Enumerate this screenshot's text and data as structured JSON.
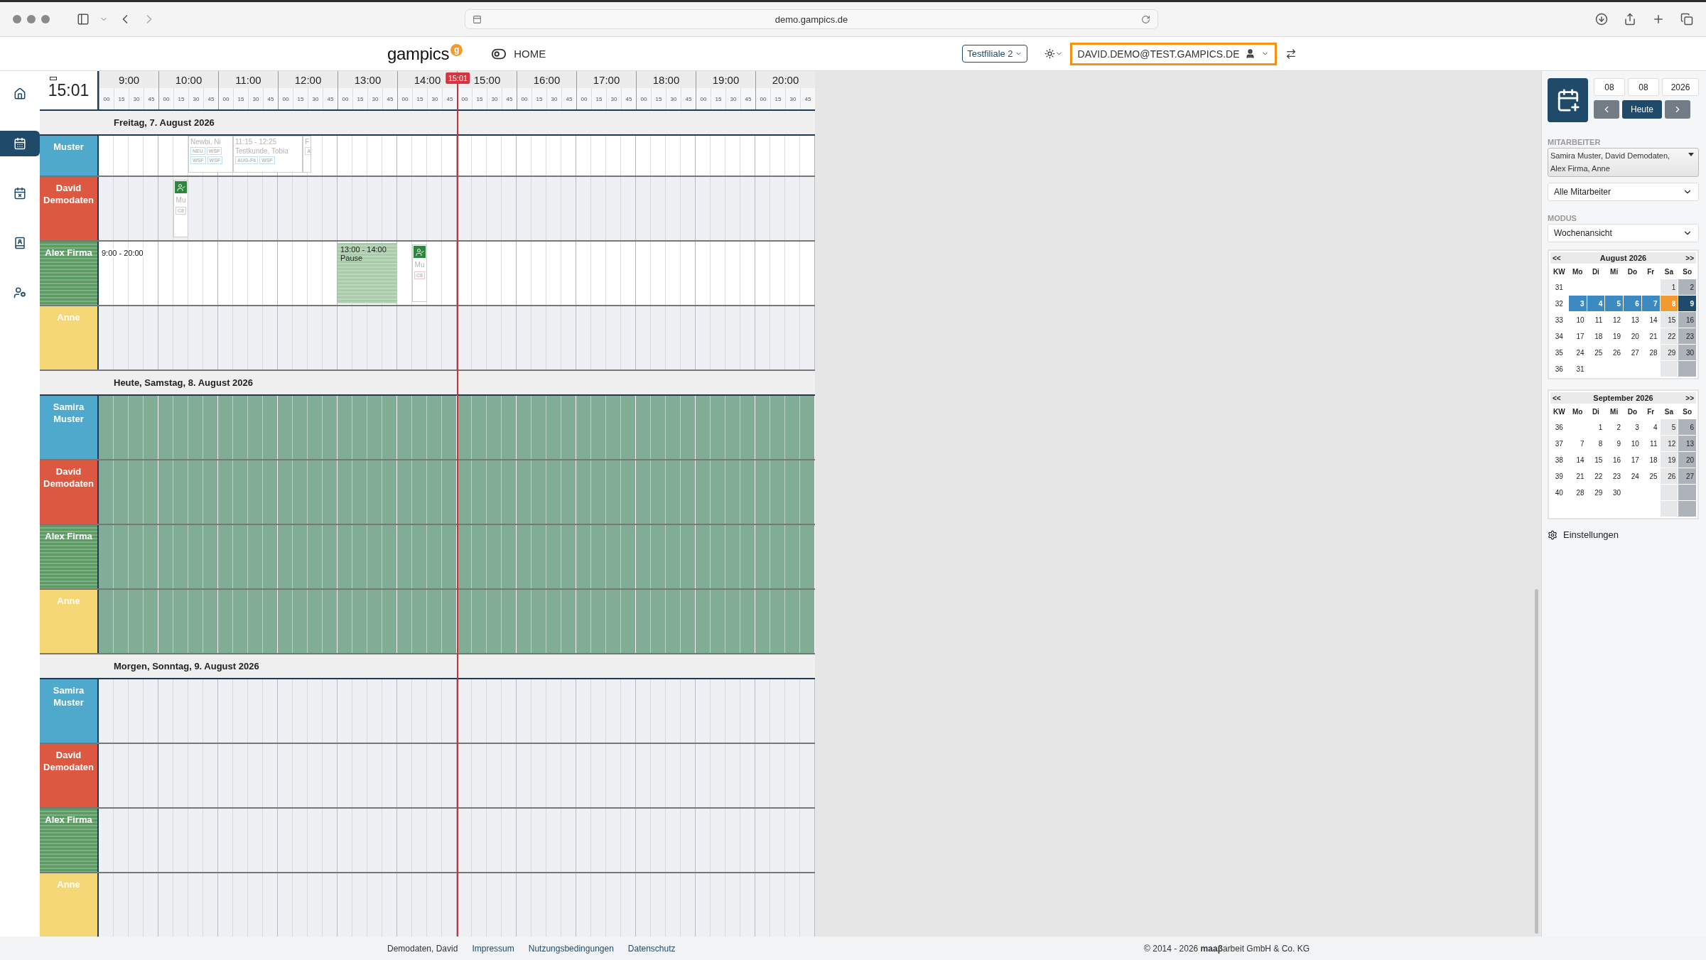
{
  "browser": {
    "url": "demo.gampics.de"
  },
  "header": {
    "logo": "gampics",
    "logo_badge": "g",
    "home": "HOME",
    "branch": "Testfiliale 2",
    "user": "DAVID.DEMO@TEST.GAMPICS.DE"
  },
  "nav": [
    {
      "kind": "home",
      "selected": false
    },
    {
      "kind": "calendar",
      "selected": true
    },
    {
      "kind": "calendar-x",
      "selected": false
    },
    {
      "kind": "contacts",
      "selected": false
    },
    {
      "kind": "user-settings",
      "selected": false
    }
  ],
  "timeline": {
    "clock": "15:01",
    "now": "15:01",
    "hours": [
      {
        "label": "9:00",
        "quarters": [
          "00",
          "15",
          "30",
          "45"
        ]
      },
      {
        "label": "10:00",
        "quarters": [
          "00",
          "15",
          "30",
          "45"
        ]
      },
      {
        "label": "11:00",
        "quarters": [
          "00",
          "15",
          "30",
          "45"
        ]
      },
      {
        "label": "12:00",
        "quarters": [
          "00",
          "15",
          "30",
          "45"
        ]
      },
      {
        "label": "13:00",
        "quarters": [
          "00",
          "15",
          "30",
          "45"
        ]
      },
      {
        "label": "14:00",
        "quarters": [
          "00",
          "15",
          "30",
          "45"
        ]
      },
      {
        "label": "15:00",
        "quarters": [
          "00",
          "15",
          "30",
          "45"
        ]
      },
      {
        "label": "16:00",
        "quarters": [
          "00",
          "15",
          "30",
          "45"
        ]
      },
      {
        "label": "17:00",
        "quarters": [
          "00",
          "15",
          "30",
          "45"
        ]
      },
      {
        "label": "18:00",
        "quarters": [
          "00",
          "15",
          "30",
          "45"
        ]
      },
      {
        "label": "19:00",
        "quarters": [
          "00",
          "15",
          "30",
          "45"
        ]
      },
      {
        "label": "20:00",
        "quarters": [
          "00",
          "15",
          "30",
          "45"
        ]
      }
    ]
  },
  "days": [
    {
      "title": "Freitag, 7. August 2026",
      "rows": [
        {
          "name": "Muster",
          "color": "#4fa9cc",
          "striped": false,
          "partial": true,
          "kind": "working",
          "events": [
            {
              "kind": "appointment",
              "lines": [
                "Newbi, Ni"
              ],
              "tags": [
                "NEU",
                "WSF",
                "WSF",
                "WSF"
              ]
            },
            {
              "kind": "appointment",
              "time": "11:15 - 12:25",
              "lines": [
                "Testkunde, Tobia"
              ],
              "tags": [
                "AUG-Fä",
                "WSF"
              ]
            },
            {
              "kind": "appointment",
              "lines": [
                "F"
              ],
              "tags": [
                "A"
              ]
            }
          ]
        },
        {
          "name": "David Demodaten",
          "color": "#dc5840",
          "striped": false,
          "partial": false,
          "kind": "off",
          "events": [
            {
              "kind": "checkin",
              "lines": [
                "Mu"
              ],
              "tags": [
                "C8"
              ]
            }
          ]
        },
        {
          "name": "Alex Firma",
          "color": "#5b9a62",
          "striped": true,
          "partial": false,
          "kind": "working",
          "shift": "9:00 - 20:00",
          "events": [
            {
              "kind": "pause",
              "time": "13:00 - 14:00",
              "lines": [
                "Pause"
              ]
            },
            {
              "kind": "checkin",
              "lines": [
                "Mu"
              ],
              "tags": [
                "C8"
              ]
            }
          ]
        },
        {
          "name": "Anne",
          "color": "#f6d776",
          "striped": false,
          "partial": false,
          "kind": "off",
          "events": []
        }
      ]
    },
    {
      "title": "Heute, Samstag, 8. August 2026",
      "rows": [
        {
          "name": "Samira Muster",
          "color": "#4fa9cc",
          "striped": false,
          "partial": false,
          "kind": "holiday",
          "events": []
        },
        {
          "name": "David Demodaten",
          "color": "#dc5840",
          "striped": false,
          "partial": false,
          "kind": "holiday",
          "events": []
        },
        {
          "name": "Alex Firma",
          "color": "#5b9a62",
          "striped": true,
          "partial": false,
          "kind": "holiday",
          "events": []
        },
        {
          "name": "Anne",
          "color": "#f6d776",
          "striped": false,
          "partial": false,
          "kind": "holiday",
          "events": []
        }
      ]
    },
    {
      "title": "Morgen, Sonntag, 9. August 2026",
      "rows": [
        {
          "name": "Samira Muster",
          "color": "#4fa9cc",
          "striped": false,
          "partial": false,
          "kind": "off",
          "events": []
        },
        {
          "name": "David Demodaten",
          "color": "#dc5840",
          "striped": false,
          "partial": false,
          "kind": "off",
          "events": []
        },
        {
          "name": "Alex Firma",
          "color": "#5b9a62",
          "striped": true,
          "partial": false,
          "kind": "off",
          "events": []
        },
        {
          "name": "Anne",
          "color": "#f6d776",
          "striped": false,
          "partial": false,
          "kind": "off",
          "events": []
        }
      ]
    }
  ],
  "sidebar": {
    "date": [
      "08",
      "08",
      "2026"
    ],
    "today": "Heute",
    "staff_label": "MITARBEITER",
    "staff": "Samira Muster, David Demodaten, Alex Firma, Anne",
    "staff_filter": "Alle Mitarbeiter",
    "mode_label": "MODUS",
    "mode": "Wochenansicht",
    "calendars": [
      {
        "prev": "<<",
        "title": "August 2026",
        "next": ">>",
        "headers": [
          "KW",
          "Mo",
          "Di",
          "Mi",
          "Do",
          "Fr",
          "Sa",
          "So"
        ],
        "weeks": [
          {
            "kw": "31",
            "days": [
              {
                "empty": true
              },
              {
                "empty": true
              },
              {
                "empty": true
              },
              {
                "empty": true
              },
              {
                "empty": true
              },
              {
                "d": "1",
                "selected": false,
                "today": false
              },
              {
                "d": "2",
                "selected": false,
                "today": false
              }
            ]
          },
          {
            "kw": "32",
            "days": [
              {
                "d": "3",
                "selected": true,
                "today": false
              },
              {
                "d": "4",
                "selected": true,
                "today": false
              },
              {
                "d": "5",
                "selected": true,
                "today": false
              },
              {
                "d": "6",
                "selected": true,
                "today": false
              },
              {
                "d": "7",
                "selected": true,
                "today": false
              },
              {
                "d": "8",
                "selected": true,
                "today": true
              },
              {
                "d": "9",
                "selected": true,
                "today": false
              }
            ]
          },
          {
            "kw": "33",
            "days": [
              {
                "d": "10",
                "selected": false,
                "today": false
              },
              {
                "d": "11",
                "selected": false,
                "today": false
              },
              {
                "d": "12",
                "selected": false,
                "today": false
              },
              {
                "d": "13",
                "selected": false,
                "today": false
              },
              {
                "d": "14",
                "selected": false,
                "today": false
              },
              {
                "d": "15",
                "selected": false,
                "today": false
              },
              {
                "d": "16",
                "selected": false,
                "today": false
              }
            ]
          },
          {
            "kw": "34",
            "days": [
              {
                "d": "17",
                "selected": false,
                "today": false
              },
              {
                "d": "18",
                "selected": false,
                "today": false
              },
              {
                "d": "19",
                "selected": false,
                "today": false
              },
              {
                "d": "20",
                "selected": false,
                "today": false
              },
              {
                "d": "21",
                "selected": false,
                "today": false
              },
              {
                "d": "22",
                "selected": false,
                "today": false
              },
              {
                "d": "23",
                "selected": false,
                "today": false
              }
            ]
          },
          {
            "kw": "35",
            "days": [
              {
                "d": "24",
                "selected": false,
                "today": false
              },
              {
                "d": "25",
                "selected": false,
                "today": false
              },
              {
                "d": "26",
                "selected": false,
                "today": false
              },
              {
                "d": "27",
                "selected": false,
                "today": false
              },
              {
                "d": "28",
                "selected": false,
                "today": false
              },
              {
                "d": "29",
                "selected": false,
                "today": false
              },
              {
                "d": "30",
                "selected": false,
                "today": false
              }
            ]
          },
          {
            "kw": "36",
            "days": [
              {
                "d": "31",
                "selected": false,
                "today": false
              },
              {
                "empty": true
              },
              {
                "empty": true
              },
              {
                "empty": true
              },
              {
                "empty": true
              },
              {
                "empty": true
              },
              {
                "empty": true
              }
            ]
          }
        ]
      },
      {
        "prev": "<<",
        "title": "September 2026",
        "next": ">>",
        "headers": [
          "KW",
          "Mo",
          "Di",
          "Mi",
          "Do",
          "Fr",
          "Sa",
          "So"
        ],
        "weeks": [
          {
            "kw": "36",
            "days": [
              {
                "empty": true
              },
              {
                "d": "1",
                "selected": false,
                "today": false
              },
              {
                "d": "2",
                "selected": false,
                "today": false
              },
              {
                "d": "3",
                "selected": false,
                "today": false
              },
              {
                "d": "4",
                "selected": false,
                "today": false
              },
              {
                "d": "5",
                "selected": false,
                "today": false
              },
              {
                "d": "6",
                "selected": false,
                "today": false
              }
            ]
          },
          {
            "kw": "37",
            "days": [
              {
                "d": "7",
                "selected": false,
                "today": false
              },
              {
                "d": "8",
                "selected": false,
                "today": false
              },
              {
                "d": "9",
                "selected": false,
                "today": false
              },
              {
                "d": "10",
                "selected": false,
                "today": false
              },
              {
                "d": "11",
                "selected": false,
                "today": false
              },
              {
                "d": "12",
                "selected": false,
                "today": false
              },
              {
                "d": "13",
                "selected": false,
                "today": false
              }
            ]
          },
          {
            "kw": "38",
            "days": [
              {
                "d": "14",
                "selected": false,
                "today": false
              },
              {
                "d": "15",
                "selected": false,
                "today": false
              },
              {
                "d": "16",
                "selected": false,
                "today": false
              },
              {
                "d": "17",
                "selected": false,
                "today": false
              },
              {
                "d": "18",
                "selected": false,
                "today": false
              },
              {
                "d": "19",
                "selected": false,
                "today": false
              },
              {
                "d": "20",
                "selected": false,
                "today": false
              }
            ]
          },
          {
            "kw": "39",
            "days": [
              {
                "d": "21",
                "selected": false,
                "today": false
              },
              {
                "d": "22",
                "selected": false,
                "today": false
              },
              {
                "d": "23",
                "selected": false,
                "today": false
              },
              {
                "d": "24",
                "selected": false,
                "today": false
              },
              {
                "d": "25",
                "selected": false,
                "today": false
              },
              {
                "d": "26",
                "selected": false,
                "today": false
              },
              {
                "d": "27",
                "selected": false,
                "today": false
              }
            ]
          },
          {
            "kw": "40",
            "days": [
              {
                "d": "28",
                "selected": false,
                "today": false
              },
              {
                "d": "29",
                "selected": false,
                "today": false
              },
              {
                "d": "30",
                "selected": false,
                "today": false
              },
              {
                "empty": true
              },
              {
                "empty": true
              },
              {
                "empty": true
              },
              {
                "empty": true
              }
            ]
          },
          {
            "days": [
              {
                "empty": true
              },
              {
                "empty": true
              },
              {
                "empty": true
              },
              {
                "empty": true
              },
              {
                "empty": true
              },
              {
                "empty": true
              },
              {
                "empty": true
              }
            ]
          }
        ]
      }
    ],
    "settings": "Einstellungen"
  },
  "footer": {
    "user": "Demodaten, David",
    "links": [
      "Impressum",
      "Nutzungsbedingungen",
      "Datenschutz"
    ],
    "copyright": "© 2014 - 2026 **maaβ**arbeit GmbH & Co. KG"
  }
}
